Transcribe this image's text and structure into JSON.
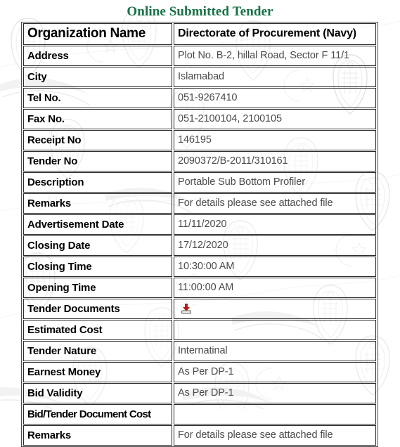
{
  "page": {
    "title": "Online Submitted Tender",
    "title_color": "#177245",
    "background_color": "#ffffff",
    "watermark": "faint-state-emblem-crest-pattern"
  },
  "table": {
    "rows": [
      {
        "label": "Organization Name",
        "value": "Directorate of Procurement (Navy)",
        "emphasis": true
      },
      {
        "label": "Address",
        "value": "Plot No. B-2, hillal Road, Sector F 11/1"
      },
      {
        "label": "City",
        "value": "Islamabad"
      },
      {
        "label": "Tel No.",
        "value": "051-9267410"
      },
      {
        "label": "Fax No.",
        "value": "051-2100104, 2100105"
      },
      {
        "label": "Receipt No",
        "value": "146195"
      },
      {
        "label": "Tender No",
        "value": "2090372/B-2011/310161"
      },
      {
        "label": "Description",
        "value": "Portable Sub Bottom Profiler"
      },
      {
        "label": "Remarks",
        "value": "For details please see attached file"
      },
      {
        "label": "Advertisement Date",
        "value": "11/11/2020"
      },
      {
        "label": "Closing Date",
        "value": "17/12/2020"
      },
      {
        "label": "Closing Time",
        "value": "10:30:00 AM"
      },
      {
        "label": "Opening Time",
        "value": "11:00:00 AM"
      },
      {
        "label": "Tender Documents",
        "value": "",
        "icon": "download-icon"
      },
      {
        "label": "Estimated Cost",
        "value": ""
      },
      {
        "label": "Tender Nature",
        "value": "Internatinal"
      },
      {
        "label": "Earnest Money",
        "value": "As Per DP-1"
      },
      {
        "label": "Bid Validity",
        "value": "As Per DP-1"
      },
      {
        "label": "Bid/Tender Document Cost",
        "value": "",
        "tight": true
      },
      {
        "label": "Remarks",
        "value": "For details please see attached file"
      }
    ]
  },
  "icons": {
    "download": {
      "name": "download-icon",
      "arrow_color": "#b61c1c",
      "tray_color": "#d8d8d0"
    }
  }
}
